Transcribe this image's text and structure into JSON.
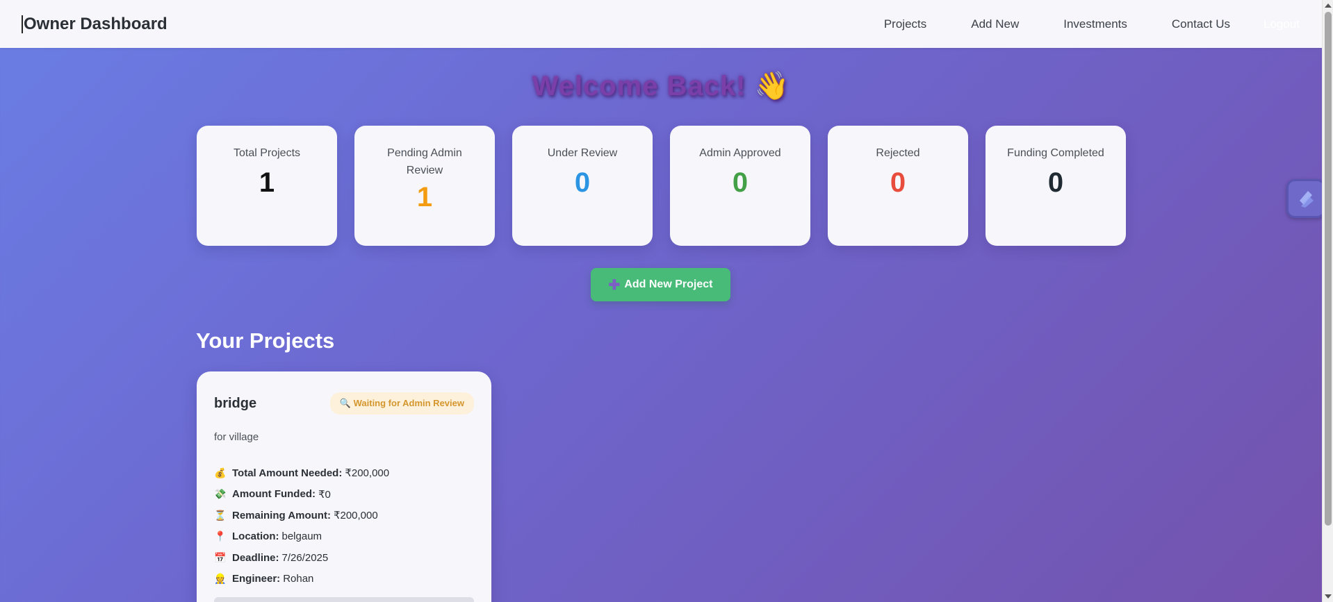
{
  "navbar": {
    "brand": "Owner Dashboard",
    "links": [
      "Projects",
      "Add New",
      "Investments",
      "Contact Us"
    ],
    "logout": "Logout"
  },
  "welcome": "Welcome Back! 👋",
  "stats": [
    {
      "label": "Total Projects",
      "value": "1",
      "color": "#111111"
    },
    {
      "label": "Pending Admin Review",
      "value": "1",
      "color": "#f39c12"
    },
    {
      "label": "Under Review",
      "value": "0",
      "color": "#2b95e3"
    },
    {
      "label": "Admin Approved",
      "value": "0",
      "color": "#43a047"
    },
    {
      "label": "Rejected",
      "value": "0",
      "color": "#e74c3c"
    },
    {
      "label": "Funding Completed",
      "value": "0",
      "color": "#1f2a33"
    }
  ],
  "add_button": {
    "icon": "plus-icon",
    "label": "Add New Project"
  },
  "section_title": "Your Projects",
  "project": {
    "title": "bridge",
    "status": "🔍 Waiting for Admin Review",
    "description": "for village",
    "details": [
      {
        "icon": "💰",
        "label": "Total Amount Needed:",
        "value": "₹200,000"
      },
      {
        "icon": "💸",
        "label": "Amount Funded:",
        "value": "₹0"
      },
      {
        "icon": "⏳",
        "label": "Remaining Amount:",
        "value": "₹200,000"
      },
      {
        "icon": "📍",
        "label": "Location:",
        "value": "belgaum"
      },
      {
        "icon": "📅",
        "label": "Deadline:",
        "value": "7/26/2025"
      },
      {
        "icon": "👷",
        "label": "Engineer:",
        "value": "Rohan"
      }
    ]
  }
}
